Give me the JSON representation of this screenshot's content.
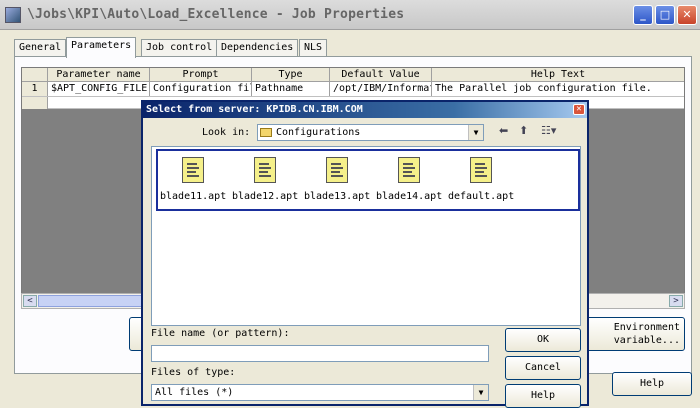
{
  "window": {
    "title": "\\Jobs\\KPI\\Auto\\Load_Excellence - Job Properties",
    "minimize": "_",
    "maximize": "□",
    "close": "✕"
  },
  "tabs": [
    {
      "label": "General"
    },
    {
      "label": "Parameters"
    },
    {
      "label": "Job control"
    },
    {
      "label": "Dependencies"
    },
    {
      "label": "NLS"
    }
  ],
  "grid": {
    "columns": [
      "Parameter name",
      "Prompt",
      "Type",
      "Default Value",
      "Help Text"
    ],
    "rows": [
      {
        "num": "1",
        "name": "$APT_CONFIG_FILE",
        "prompt": "Configuration fil",
        "type": "Pathname",
        "default": "/opt/IBM/Informat",
        "help": "The Parallel job configuration file."
      }
    ]
  },
  "scroll": {
    "left": "<",
    "right": ">"
  },
  "buttons": {
    "environment": "Environment variable...",
    "help": "Help"
  },
  "dialog": {
    "title": "Select from server: KPIDB.CN.IBM.COM",
    "close": "✕",
    "look_in_label": "Look in:",
    "look_in_value": "Configurations",
    "files": [
      {
        "name": "blade11.apt"
      },
      {
        "name": "blade12.apt"
      },
      {
        "name": "blade13.apt"
      },
      {
        "name": "blade14.apt"
      },
      {
        "name": "default.apt"
      }
    ],
    "filename_label": "File name (or pattern):",
    "filename_value": "",
    "filetype_label": "Files of type:",
    "filetype_value": "All files (*)",
    "ok": "OK",
    "cancel": "Cancel",
    "help": "Help"
  }
}
